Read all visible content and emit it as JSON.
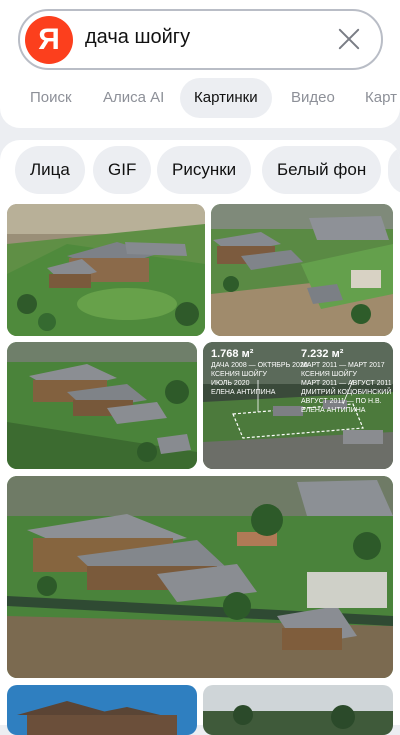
{
  "search": {
    "query": "дача шойгу",
    "logo_letter": "Я"
  },
  "tabs": [
    "Поиск",
    "Алиса AI",
    "Картинки",
    "Видео",
    "Карт"
  ],
  "chips": [
    "Лица",
    "GIF",
    "Рисунки",
    "Белый фон"
  ],
  "results": {
    "tile4": {
      "left_area": "1.768 м²",
      "left_caption": "ДАЧА 2008 — ОКТЯБРЬ 2020",
      "left_owner": "КСЕНИЯ ШОЙГУ",
      "left_sub": "ИЮЛЬ 2020",
      "left_owner2": "ЕЛЕНА АНТИПИНА",
      "right_area": "7.232 м²",
      "right_caption": "МАРТ 2011 — МАРТ 2017",
      "right_owner": "КСЕНИЯ ШОЙГУ",
      "right_sub": "МАРТ 2011 — АВГУСТ 2011",
      "right_owner2": "ДМИТРИЙ КОЦОБИНСКИЙ",
      "right_sub2": "АВГУСТ 2011 — ПО Н.В.",
      "right_owner3": "ЕЛЕНА АНТИПИНА"
    }
  },
  "colors": {
    "brand": "#fc3f1d",
    "grass": "#4f8f3a",
    "roof": "#8a8d92"
  }
}
